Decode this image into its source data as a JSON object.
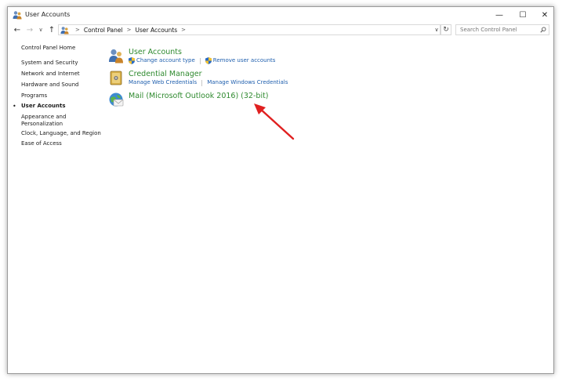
{
  "window": {
    "title": "User Accounts",
    "controls": {
      "minimize": "—",
      "maximize": "☐",
      "close": "✕"
    }
  },
  "address": {
    "back": "←",
    "forward": "→",
    "recent": "∨",
    "up": "↑",
    "breadcrumbs": [
      "Control Panel",
      "User Accounts"
    ],
    "separator": ">",
    "dropdown": "∨",
    "refresh": "↻",
    "search_placeholder": "Search Control Panel"
  },
  "sidebar": {
    "items": [
      {
        "label": "Control Panel Home"
      },
      {
        "label": "System and Security"
      },
      {
        "label": "Network and Internet"
      },
      {
        "label": "Hardware and Sound"
      },
      {
        "label": "Programs"
      },
      {
        "label": "User Accounts",
        "current": true
      },
      {
        "label": "Appearance and"
      },
      {
        "label": "Personalization"
      },
      {
        "label": "Clock, Language, and Region"
      },
      {
        "label": "Ease of Access"
      }
    ],
    "bullet": "•"
  },
  "main": {
    "categories": [
      {
        "title": "User Accounts",
        "icon": "users-icon",
        "links": [
          "Change account type",
          "Remove user accounts"
        ]
      },
      {
        "title": "Credential Manager",
        "icon": "credential-vault-icon",
        "links": [
          "Manage Web Credentials",
          "Manage Windows Credentials"
        ]
      },
      {
        "title": "Mail (Microsoft Outlook 2016) (32-bit)",
        "icon": "mail-icon",
        "links": []
      }
    ]
  },
  "colors": {
    "category_title": "#2f8a2f",
    "link": "#1f5fae",
    "annotation_arrow": "#e02020"
  }
}
